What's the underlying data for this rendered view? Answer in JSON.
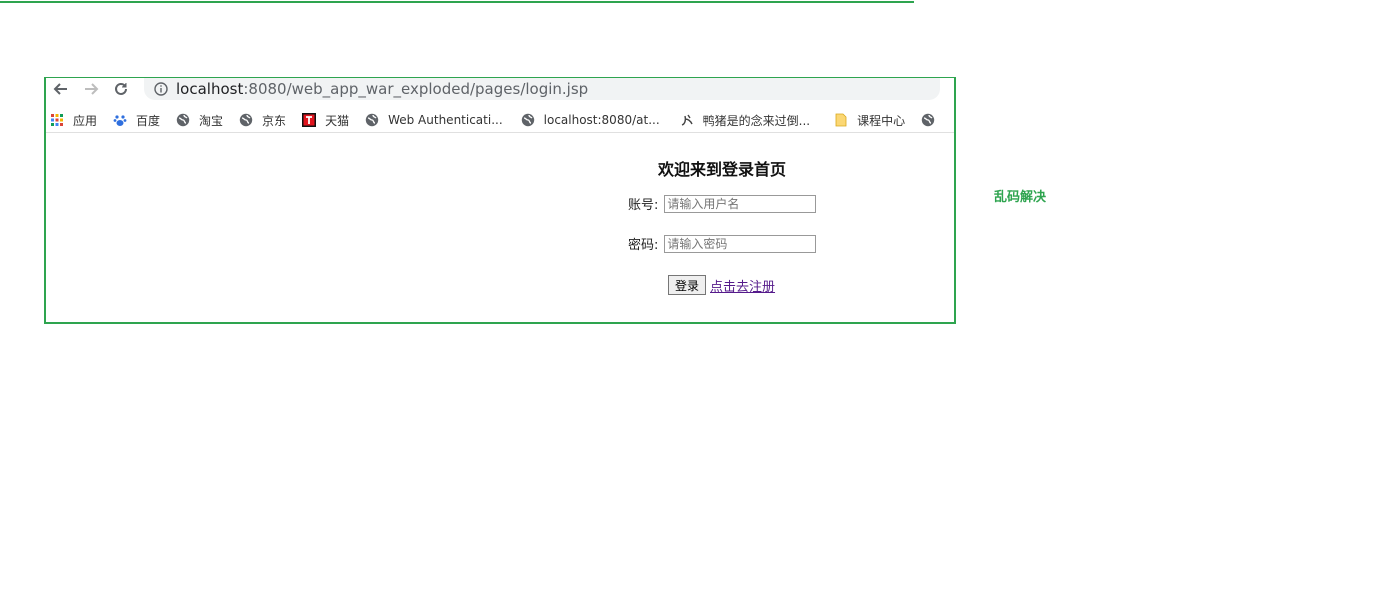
{
  "browser": {
    "url_host": "localhost",
    "url_rest": ":8080/web_app_war_exploded/pages/login.jsp"
  },
  "bookmarks": [
    {
      "label": "应用",
      "icon": "apps-grid-icon"
    },
    {
      "label": "百度",
      "icon": "baidu-paw-icon"
    },
    {
      "label": "淘宝",
      "icon": "globe-icon"
    },
    {
      "label": "京东",
      "icon": "globe-icon"
    },
    {
      "label": "天猫",
      "icon": "tmall-icon"
    },
    {
      "label": "Web Authenticati...",
      "icon": "globe-icon"
    },
    {
      "label": "localhost:8080/at...",
      "icon": "globe-icon"
    },
    {
      "label": "鸭猪是的念来过倒...",
      "icon": "site-icon"
    },
    {
      "label": "课程中心",
      "icon": "folder-icon"
    },
    {
      "label": "",
      "icon": "globe-icon"
    }
  ],
  "login": {
    "title": "欢迎来到登录首页",
    "username_label": "账号:",
    "username_placeholder": "请输入用户名",
    "password_label": "密码:",
    "password_placeholder": "请输入密码",
    "submit_label": "登录",
    "register_link": "点击去注册"
  },
  "note": "乱码解决",
  "colors": {
    "frame_border": "#2ea44f",
    "note_text": "#2ea44f",
    "link": "#551a8b"
  }
}
